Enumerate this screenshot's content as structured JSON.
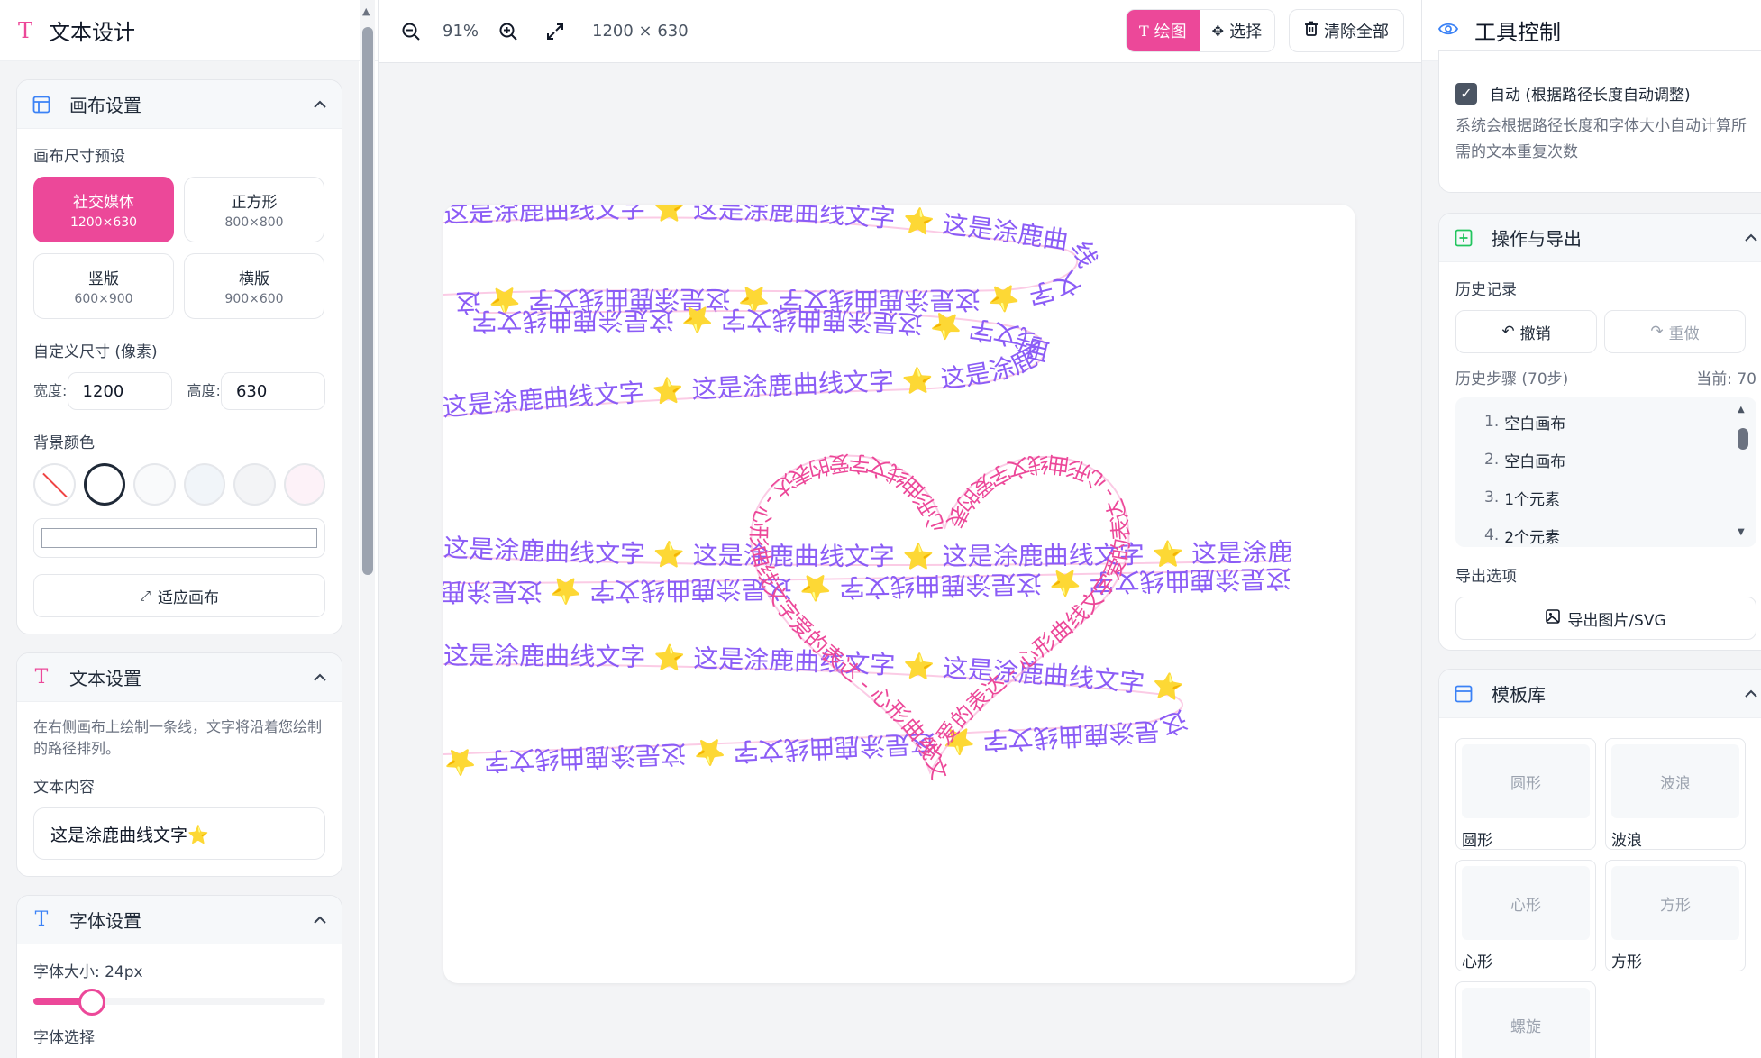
{
  "app": {
    "title": "文本设计"
  },
  "canvas_settings": {
    "title": "画布设置",
    "preset_label": "画布尺寸预设",
    "presets": [
      {
        "name": "社交媒体",
        "size": "1200×630",
        "active": true
      },
      {
        "name": "正方形",
        "size": "800×800",
        "active": false
      },
      {
        "name": "竖版",
        "size": "600×900",
        "active": false
      },
      {
        "name": "横版",
        "size": "900×600",
        "active": false
      }
    ],
    "custom_label": "自定义尺寸 (像素)",
    "width_label": "宽度:",
    "width_value": "1200",
    "height_label": "高度:",
    "height_value": "630",
    "bg_label": "背景颜色",
    "swatches": [
      "none",
      "#ffffff",
      "#f9fafb",
      "#f1f5f9",
      "#f3f4f6",
      "#fdf2f8"
    ],
    "fit_label": "适应画布"
  },
  "text_settings": {
    "title": "文本设置",
    "help": "在右侧画布上绘制一条线，文字将沿着您绘制的路径排列。",
    "content_label": "文本内容",
    "content_value": "这是涂鹿曲线文字⭐"
  },
  "font_settings": {
    "title": "字体设置",
    "size_label": "字体大小: 24px",
    "size_fraction": 0.2,
    "next_label": "字体选择"
  },
  "toolbar": {
    "zoom": "91%",
    "dims": "1200 × 630",
    "draw_label": "绘图",
    "select_label": "选择",
    "clear_label": "清除全部"
  },
  "canvas_text": {
    "repeat": "这是涂鹿曲线文字 ⭐ ",
    "heart": "心形曲线文字爱的表达 - ",
    "accent_text": "#8b5cf6",
    "accent_heart": "#ec4899"
  },
  "tools": {
    "title": "工具控制",
    "auto_label": "自动 (根据路径长度自动调整)",
    "auto_help": "系统会根据路径长度和字体大小自动计算所需的文本重复次数"
  },
  "ops": {
    "title": "操作与导出",
    "history_label": "历史记录",
    "undo_label": "撤销",
    "redo_label": "重做",
    "steps_label": "历史步骤 (70步)",
    "current_label": "当前: 70",
    "history": [
      {
        "n": "1.",
        "t": "空白画布"
      },
      {
        "n": "2.",
        "t": "空白画布"
      },
      {
        "n": "3.",
        "t": "1个元素"
      },
      {
        "n": "4.",
        "t": "2个元素"
      }
    ],
    "export_label": "导出选项",
    "export_button": "导出图片/SVG"
  },
  "templates": {
    "title": "模板库",
    "items": [
      {
        "preview": "圆形",
        "name": "圆形"
      },
      {
        "preview": "波浪",
        "name": "波浪"
      },
      {
        "preview": "心形",
        "name": "心形"
      },
      {
        "preview": "方形",
        "name": "方形"
      },
      {
        "preview": "螺旋",
        "name": ""
      }
    ]
  },
  "colors": {
    "brand": "#ec4899",
    "blue": "#3b82f6",
    "green": "#22c55e"
  }
}
